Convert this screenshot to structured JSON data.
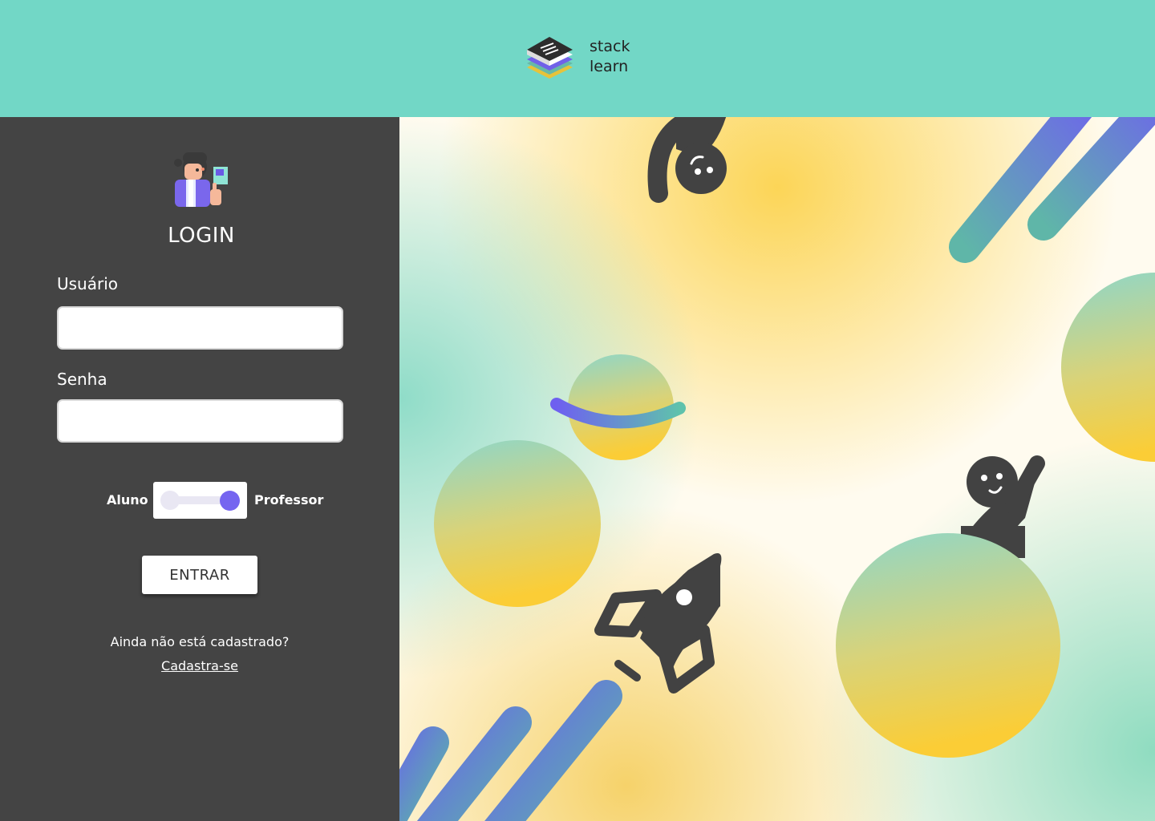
{
  "header": {
    "logo_line1": "stack",
    "logo_line2": "learn",
    "logo_icon": "stacked-books-icon"
  },
  "login": {
    "avatar_icon": "teacher-avatar-icon",
    "title": "LOGIN",
    "username_label": "Usuário",
    "username_value": "",
    "password_label": "Senha",
    "password_value": "",
    "toggle": {
      "left_label": "Aluno",
      "right_label": "Professor",
      "selected": "Professor"
    },
    "submit_label": "ENTRAR",
    "signup_question": "Ainda não está cadastrado?",
    "signup_link": "Cadastra-se"
  },
  "illustration": {
    "elements": [
      "falling-person",
      "planet-with-ring",
      "rocket",
      "waving-person-on-planet",
      "planets",
      "speed-stripes"
    ]
  },
  "colors": {
    "header_bg": "#72d7c6",
    "panel_bg": "#444444",
    "accent": "#7565f0",
    "figure": "#424242"
  }
}
